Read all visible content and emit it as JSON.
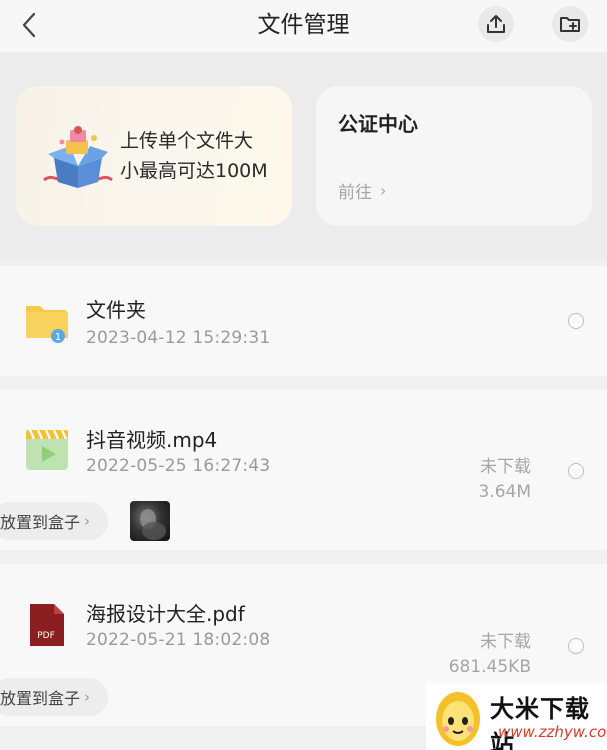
{
  "header": {
    "title": "文件管理",
    "back_icon": "chevron-left-icon",
    "upload_icon": "upload-icon",
    "new_folder_icon": "folder-add-icon"
  },
  "promo": {
    "line1": "上传单个文件大",
    "line2": "小最高可达100M",
    "icon": "gift-box-icon"
  },
  "notary": {
    "title": "公证中心",
    "link": "前往"
  },
  "files": [
    {
      "name": "文件夹",
      "date": "2023-04-12 15:29:31",
      "type": "folder",
      "badge": "1"
    },
    {
      "name": "抖音视频.mp4",
      "date": "2022-05-25 16:27:43",
      "type": "video",
      "status": "未下载",
      "size": "3.64M",
      "action": "放置到盒子"
    },
    {
      "name": "海报设计大全.pdf",
      "date": "2022-05-21 18:02:08",
      "type": "pdf",
      "type_label": "PDF",
      "status": "未下载",
      "size": "681.45KB",
      "action": "放置到盒子"
    }
  ],
  "watermark": {
    "name": "大米下载站",
    "url": "www.zzhyw.com"
  },
  "colors": {
    "folder": "#f7c94a",
    "video": "#8fcf7a",
    "pdf": "#8b1e1e",
    "accent": "#d23a2a"
  }
}
